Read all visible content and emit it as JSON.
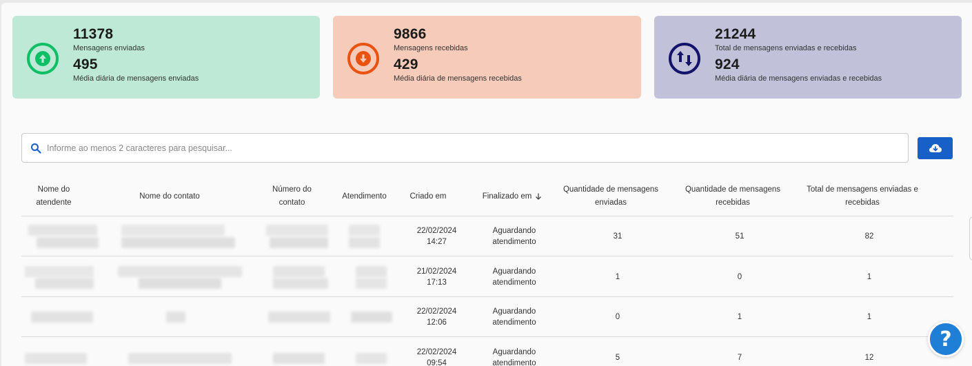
{
  "stats": {
    "sent": {
      "total": "11378",
      "total_label": "Mensagens enviadas",
      "daily": "495",
      "daily_label": "Média diária de mensagens enviadas",
      "color": "#0fbf66"
    },
    "received": {
      "total": "9866",
      "total_label": "Mensagens recebidas",
      "daily": "429",
      "daily_label": "Média diária de mensagens recebidas",
      "color": "#e9520f"
    },
    "combined": {
      "total": "21244",
      "total_label": "Total de mensagens enviadas e recebidas",
      "daily": "924",
      "daily_label": "Média diária de mensagens enviadas e recebidas",
      "color": "#13136b"
    }
  },
  "search": {
    "placeholder": "Informe ao menos 2 caracteres para pesquisar...",
    "value": ""
  },
  "table": {
    "columns": {
      "attendant": "Nome do atendente",
      "contact_name": "Nome do contato",
      "contact_number": "Número do contato",
      "service": "Atendimento",
      "created": "Criado em",
      "finished": "Finalizado em",
      "sent_qty": "Quantidade de mensagens enviadas",
      "recv_qty": "Quantidade de mensagens recebidas",
      "total_qty": "Total de mensagens enviadas e recebidas"
    },
    "rows": [
      {
        "created_date": "22/02/2024",
        "created_time": "14:27",
        "finished_l1": "Aguardando",
        "finished_l2": "atendimento",
        "sent": "31",
        "received": "51",
        "total": "82"
      },
      {
        "created_date": "21/02/2024",
        "created_time": "17:13",
        "finished_l1": "Aguardando",
        "finished_l2": "atendimento",
        "sent": "1",
        "received": "0",
        "total": "1"
      },
      {
        "created_date": "22/02/2024",
        "created_time": "12:06",
        "finished_l1": "Aguardando",
        "finished_l2": "atendimento",
        "sent": "0",
        "received": "1",
        "total": "1"
      },
      {
        "created_date": "22/02/2024",
        "created_time": "09:54",
        "finished_l1": "Aguardando",
        "finished_l2": "atendimento",
        "sent": "5",
        "received": "7",
        "total": "12"
      }
    ]
  },
  "help": {
    "symbol": "?"
  },
  "icons": {
    "sent": "arrow-up-circle-icon",
    "received": "arrow-down-circle-icon",
    "combined": "swap-vertical-circle-icon",
    "search": "search-icon",
    "download": "cloud-download-icon",
    "sort": "arrow-down-icon",
    "help": "help-icon"
  }
}
